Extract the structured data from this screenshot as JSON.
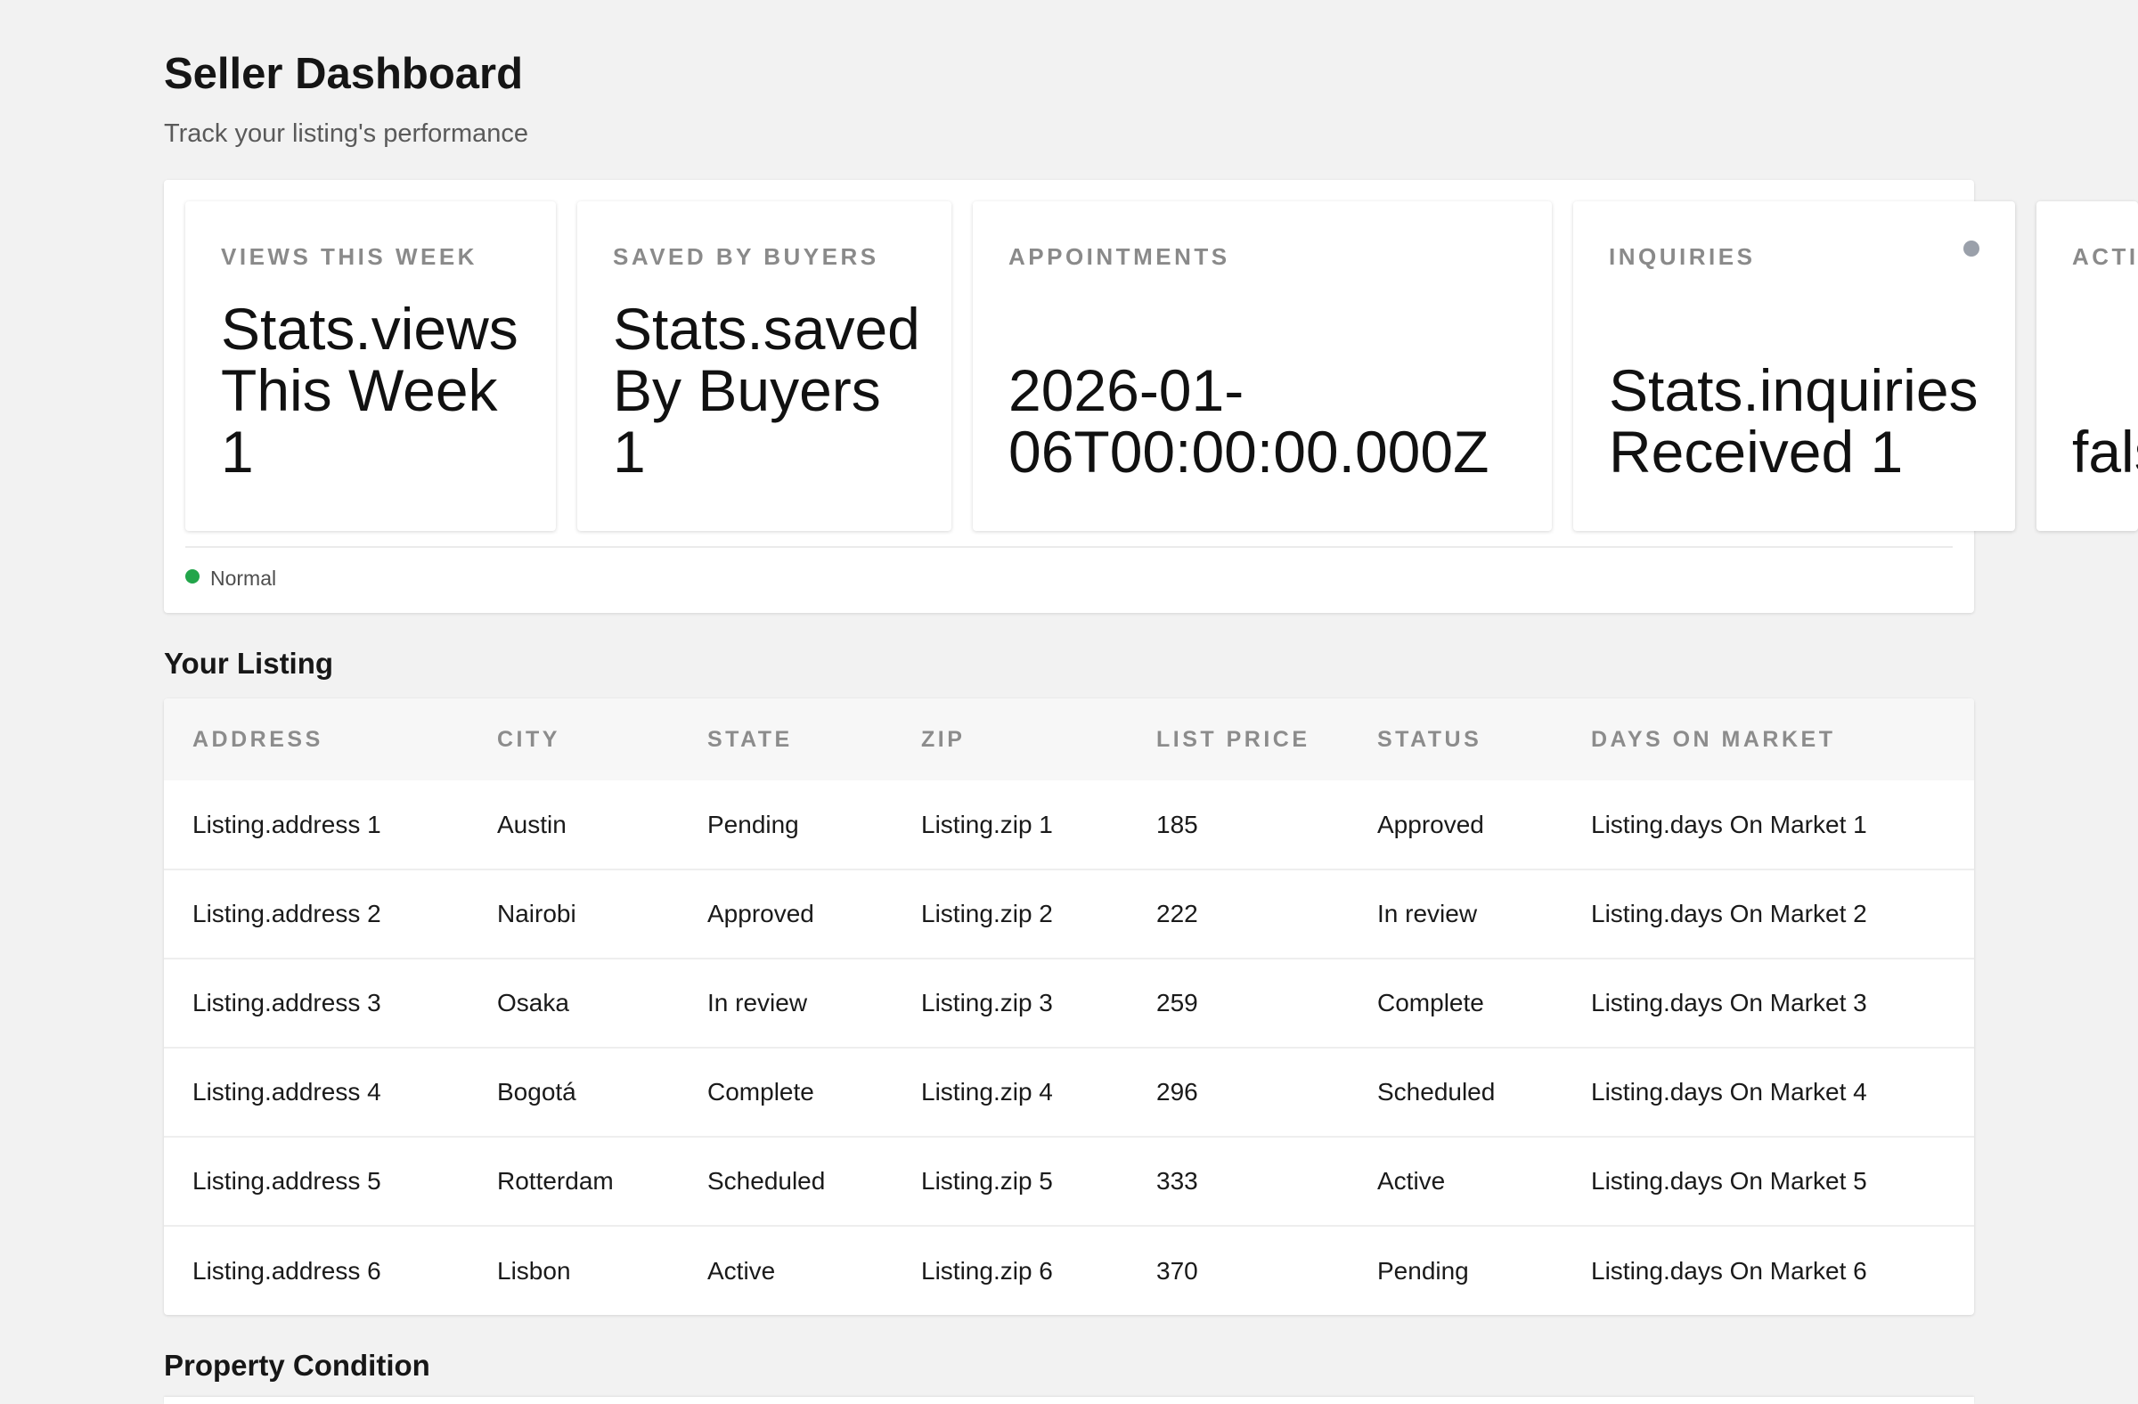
{
  "header": {
    "title": "Seller Dashboard",
    "subtitle": "Track your listing's performance"
  },
  "stats": [
    {
      "label": "Views This Week",
      "value": "Stats.views\nThis Week\n1"
    },
    {
      "label": "Saved By Buyers",
      "value": "Stats.saved\nBy Buyers\n1"
    },
    {
      "label": "Appointments",
      "value": "2026-01-\n06T00:00:00.000Z"
    },
    {
      "label": "Inquiries",
      "value": "Stats.inquiries\nReceived 1"
    },
    {
      "label": "Active Offers",
      "value": "false"
    }
  ],
  "status": {
    "text": "Normal",
    "color": "#22a54a"
  },
  "listing": {
    "title": "Your Listing",
    "columns": [
      "Address",
      "City",
      "State",
      "Zip",
      "List Price",
      "Status",
      "Days On Market"
    ],
    "rows": [
      [
        "Listing.address 1",
        "Austin",
        "Pending",
        "Listing.zip 1",
        "185",
        "Approved",
        "Listing.days On Market 1"
      ],
      [
        "Listing.address 2",
        "Nairobi",
        "Approved",
        "Listing.zip 2",
        "222",
        "In review",
        "Listing.days On Market 2"
      ],
      [
        "Listing.address 3",
        "Osaka",
        "In review",
        "Listing.zip 3",
        "259",
        "Complete",
        "Listing.days On Market 3"
      ],
      [
        "Listing.address 4",
        "Bogotá",
        "Complete",
        "Listing.zip 4",
        "296",
        "Scheduled",
        "Listing.days On Market 4"
      ],
      [
        "Listing.address 5",
        "Rotterdam",
        "Scheduled",
        "Listing.zip 5",
        "333",
        "Active",
        "Listing.days On Market 5"
      ],
      [
        "Listing.address 6",
        "Lisbon",
        "Active",
        "Listing.zip 6",
        "370",
        "Pending",
        "Listing.days On Market 6"
      ]
    ]
  },
  "property_condition": {
    "title": "Property Condition"
  }
}
